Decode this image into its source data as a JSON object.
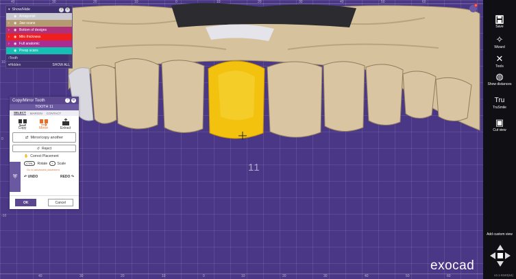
{
  "visibility_panel": {
    "header": "Show/Hide",
    "layers": [
      {
        "label": "Antagonist",
        "color": "#c9c9cf"
      },
      {
        "label": "Jaw scans",
        "color": "#b59b72"
      },
      {
        "label": "Bottom of designs",
        "color": "#b0317a"
      },
      {
        "label": "Milo thickness",
        "color": "#f01f1f"
      },
      {
        "label": "Full anatomic",
        "color": "#a92c92"
      },
      {
        "label": "Preop scans",
        "color": "#14bfb4"
      }
    ],
    "tooth_label": "Tooth",
    "hidden_label": "Hidden",
    "show_all": "SHOW ALL"
  },
  "copy_mirror": {
    "title": "Copy/Mirror Tooth",
    "subtitle": "TOOTH 11",
    "tabs": [
      "SELECT",
      "MARGIN",
      "CONTACT"
    ],
    "modes": [
      "Copy",
      "Mirror",
      "Extract"
    ],
    "mirror_another": "Mirror/copy another",
    "reject": "Reject",
    "correct_placement": "Correct Placement",
    "rotate_key": "CTRL",
    "rotate_label": "Rotate",
    "scale_label": "Scale",
    "advanced": "Go to advanced placement",
    "undo": "UNDO",
    "redo": "REDO",
    "ok": "OK",
    "cancel": "Cancel"
  },
  "viewport": {
    "tooth_number": "11",
    "ruler_top": [
      "40",
      "30",
      "20",
      "10",
      "0",
      "10",
      "20",
      "30",
      "40",
      "50",
      "60"
    ],
    "ruler_bottom": [
      "40",
      "30",
      "20",
      "10",
      "0",
      "10",
      "20",
      "30",
      "40",
      "50",
      "60"
    ],
    "ruler_left": [
      "10",
      "0",
      "-10"
    ]
  },
  "toolbar": {
    "items": [
      {
        "label": "Save",
        "icon": "save-icon"
      },
      {
        "label": "Wizard",
        "icon": "wizard-icon"
      },
      {
        "label": "Tools",
        "icon": "tools-icon"
      },
      {
        "label": "Show distances",
        "icon": "distances-icon"
      },
      {
        "label": "TruSmile",
        "icon": "trusmile-icon"
      },
      {
        "label": "Cut view",
        "icon": "cut-view-icon"
      }
    ],
    "add_custom_view": "Add custom view",
    "version": "v3.1-9340(64)",
    "notification_count": "4"
  },
  "brand": {
    "logo": "exocad"
  }
}
